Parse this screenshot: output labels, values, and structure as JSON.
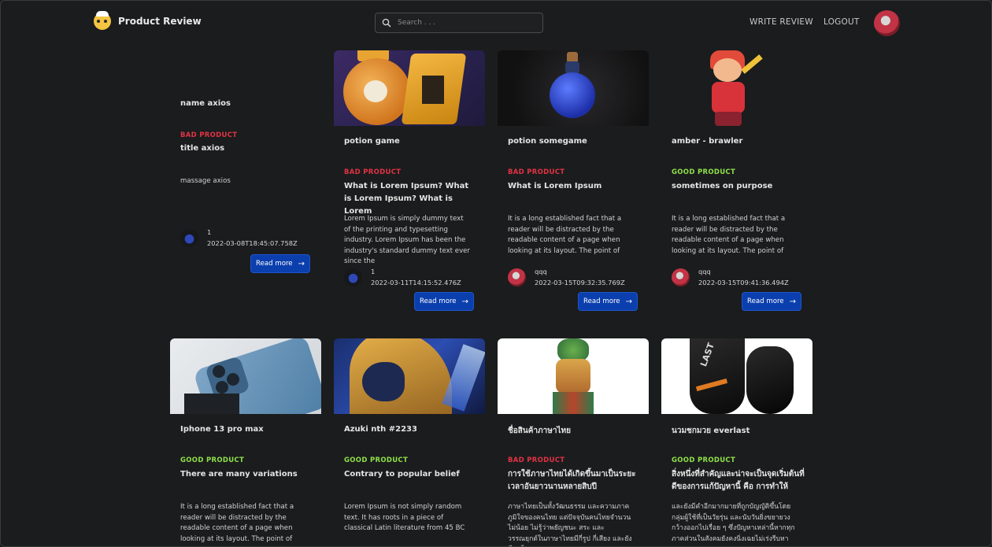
{
  "header": {
    "brand": "Product Review",
    "search_placeholder": "Search . . .",
    "write_review": "WRITE REVIEW",
    "logout": "LOGOUT"
  },
  "cards": [
    {
      "title": "name axios",
      "tag": "BAD PRODUCT",
      "subtitle": "title axios",
      "text": "massage axios",
      "author": "1",
      "date": "2022-03-08T18:45:07.758Z",
      "button": "Read more"
    },
    {
      "title": "potion game",
      "tag": "BAD PRODUCT",
      "subtitle": "What is Lorem Ipsum? What is Lorem Ipsum? What is Lorem",
      "text": "Lorem Ipsum is simply dummy text of the printing and typesetting industry. Lorem Ipsum has been the industry's standard dummy text ever since the",
      "author": "1",
      "date": "2022-03-11T14:15:52.476Z",
      "button": "Read more"
    },
    {
      "title": "potion somegame",
      "tag": "BAD PRODUCT",
      "subtitle": "What is Lorem Ipsum",
      "text": "It is a long established fact that a reader will be distracted by the readable content of a page when looking at its layout. The point of",
      "author": "qqq",
      "date": "2022-03-15T09:32:35.769Z",
      "button": "Read more"
    },
    {
      "title": "amber - brawler",
      "tag": "GOOD PRODUCT",
      "subtitle": "sometimes on purpose",
      "text": "It is a long established fact that a reader will be distracted by the readable content of a page when looking at its layout. The point of",
      "author": "qqq",
      "date": "2022-03-15T09:41:36.494Z",
      "button": "Read more"
    },
    {
      "title": "Iphone 13 pro max",
      "tag": "GOOD PRODUCT",
      "subtitle": "There are many variations",
      "text": "It is a long established fact that a reader will be distracted by the readable content of a page when looking at its layout. The point of"
    },
    {
      "title": "Azuki nth #2233",
      "tag": "GOOD PRODUCT",
      "subtitle": "Contrary to popular belief",
      "text": "Lorem Ipsum is not simply random text. It has roots in a piece of classical Latin literature from 45 BC"
    },
    {
      "title": "ชื่อสินค้าภาษาไทย",
      "tag": "BAD PRODUCT",
      "subtitle": "การใช้ภาษาไทยได้เกิดขึ้นมาเป็นระยะเวลาอันยาวนานหลายสิบปี",
      "text": "ภาษาไทยเป็นทั้งวัฒนธรรม และความภาคภูมิใจของคนไทย แต่ปัจจุบันคนไทยจำนวนไม่น้อย ไม่รู้ว่าพยัญชนะ สระ และวรรณยุกต์ในภาษาไทยมีกี่รูป กี่เสียง และยังมีคนไทย"
    },
    {
      "title": "นวมชกมวย everlast",
      "tag": "GOOD PRODUCT",
      "subtitle": "สิ่งหนึ่งที่สำคัญและน่าจะเป็นจุดเริ่มต้นที่ดีของการแก้ปัญหานี้ คือ การทำให้",
      "text": "และยังมีคำอีกมากมายที่ถูกบัญญัติขึ้นโดยกลุ่มผู้ใช้ที่เป็นวัยรุ่น และนับวันยิ่งขยายวงกว้างออกไปเรื่อย ๆ ซึ่งปัญหาเหล่านี้หากทุกภาคส่วนในสังคมยังคงนิ่งเฉยไม่เร่งรีบหา"
    }
  ]
}
